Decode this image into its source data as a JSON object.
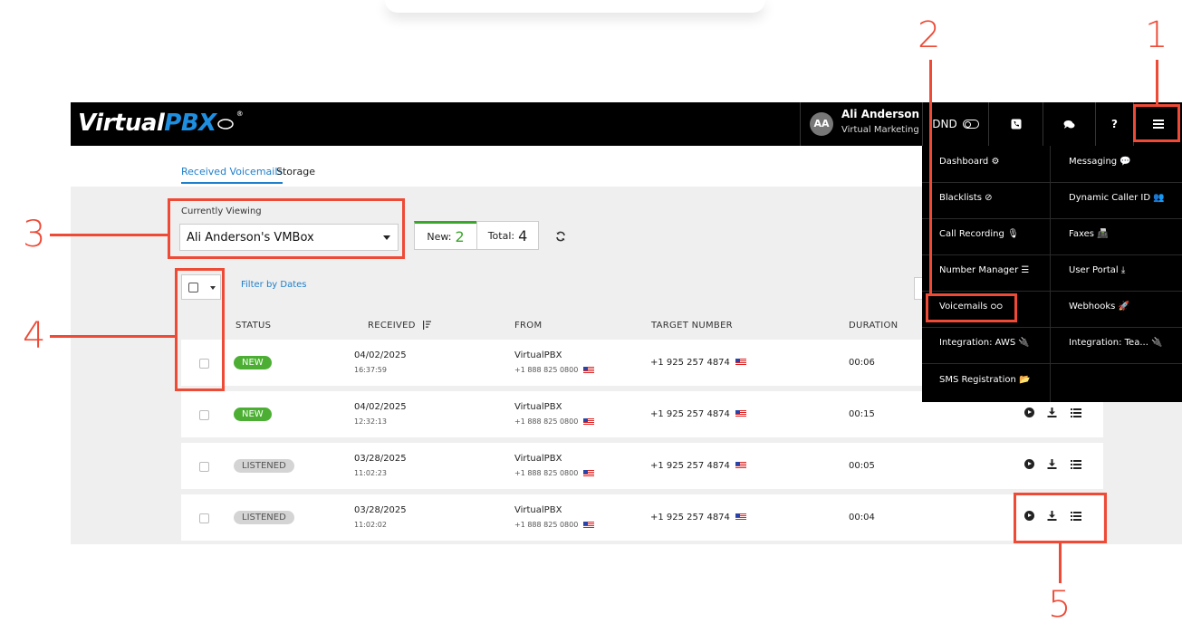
{
  "header": {
    "logo_virtual": "Virtual",
    "logo_pbx": "PBX",
    "logo_reg": "®",
    "avatar": "AA",
    "user_name": "Ali Anderson",
    "user_subtitle": "Virtual Marketing",
    "dnd_label": "DND",
    "help_label": "?"
  },
  "tabs": {
    "received": "Received Voicemails",
    "storage": "Storage"
  },
  "toolbar": {
    "currently_viewing_label": "Currently Viewing",
    "selected_box": "Ali Anderson's VMBox",
    "new_label": "New:",
    "new_count": "2",
    "total_label": "Total:",
    "total_count": "4",
    "filter_by_dates": "Filter by Dates"
  },
  "table": {
    "headers": [
      "STATUS",
      "RECEIVED",
      "FROM",
      "TARGET NUMBER",
      "DURATION"
    ],
    "rows": [
      {
        "status": "NEW",
        "date": "04/02/2025",
        "time": "16:37:59",
        "from_name": "VirtualPBX",
        "from_number": "+1 888 825 0800",
        "target": "+1 925 257 4874",
        "duration": "00:06"
      },
      {
        "status": "NEW",
        "date": "04/02/2025",
        "time": "12:32:13",
        "from_name": "VirtualPBX",
        "from_number": "+1 888 825 0800",
        "target": "+1 925 257 4874",
        "duration": "00:15"
      },
      {
        "status": "LISTENED",
        "date": "03/28/2025",
        "time": "11:02:23",
        "from_name": "VirtualPBX",
        "from_number": "+1 888 825 0800",
        "target": "+1 925 257 4874",
        "duration": "00:05"
      },
      {
        "status": "LISTENED",
        "date": "03/28/2025",
        "time": "11:02:02",
        "from_name": "VirtualPBX",
        "from_number": "+1 888 825 0800",
        "target": "+1 925 257 4874",
        "duration": "00:04"
      }
    ]
  },
  "menu": {
    "items": [
      {
        "label": "Dashboard",
        "icon": "cogs-icon"
      },
      {
        "label": "Messaging",
        "icon": "chat-icon"
      },
      {
        "label": "Blacklists",
        "icon": "ban-icon"
      },
      {
        "label": "Dynamic Caller ID",
        "icon": "users-icon"
      },
      {
        "label": "Call Recording",
        "icon": "microphone-icon"
      },
      {
        "label": "Faxes",
        "icon": "fax-icon"
      },
      {
        "label": "Number Manager",
        "icon": "list-icon"
      },
      {
        "label": "User Portal",
        "icon": "download-icon"
      },
      {
        "label": "Voicemails",
        "icon": "voicemail-icon"
      },
      {
        "label": "Webhooks",
        "icon": "rocket-icon"
      },
      {
        "label": "Integration: AWS",
        "icon": "plug-icon"
      },
      {
        "label": "Integration: Tea...",
        "icon": "plug-icon"
      },
      {
        "label": "SMS Registration",
        "icon": "folder-open-icon"
      }
    ]
  },
  "annotations": [
    "1",
    "2",
    "3",
    "4",
    "5"
  ],
  "colors": {
    "accent_blue": "#1e7fcb",
    "new_green": "#4caf34",
    "annotation_red": "#ee4a36",
    "header_black": "#000000"
  }
}
